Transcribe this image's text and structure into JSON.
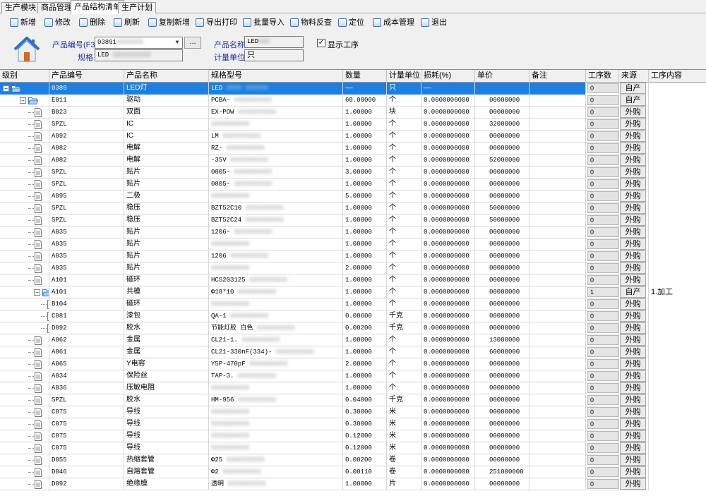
{
  "tabs": [
    {
      "label": "生产模块"
    },
    {
      "label": "商品管理"
    },
    {
      "label": "产品结构清单"
    },
    {
      "label": "生产计划"
    }
  ],
  "toolbar": [
    {
      "label": "新增"
    },
    {
      "label": "修改"
    },
    {
      "label": "删除"
    },
    {
      "label": "刷新"
    },
    {
      "label": "复制新增"
    },
    {
      "label": "导出打印"
    },
    {
      "label": "批量导入"
    },
    {
      "label": "物料反查"
    },
    {
      "label": "定位"
    },
    {
      "label": "成本管理"
    },
    {
      "label": "退出"
    }
  ],
  "form": {
    "product_code_label": "产品编号(F3)",
    "product_code_value": "03891",
    "ellipsis": "...",
    "spec_label": "规格",
    "spec_value": "LED",
    "product_name_label": "产品名称",
    "product_name_value": "LED",
    "unit_label": "计量单位",
    "unit_value": "只",
    "show_process_label": "显示工序",
    "show_process_checked": "✓"
  },
  "grid": {
    "columns": [
      "级别",
      "产品编号",
      "产品名称",
      "规格型号",
      "数量",
      "计量单位",
      "损耗(%)",
      "单价",
      "备注",
      "工序数",
      "来源",
      "工序内容"
    ],
    "rows": [
      {
        "level": 0,
        "code": "0389",
        "name": "LED灯",
        "spec": "LED",
        "qty": "——",
        "unit": "只",
        "loss": "——",
        "price": "",
        "note": "",
        "steps": "0",
        "source": "自产",
        "content": ""
      },
      {
        "level": 1,
        "code": "E011",
        "name": "驱动",
        "spec": "PCBA-",
        "qty": "60.00000",
        "unit": "个",
        "loss": "0.0000000000",
        "price": "00000000",
        "note": "",
        "steps": "0",
        "source": "自产",
        "content": ""
      },
      {
        "level": 2,
        "code": "B023",
        "name": "双面",
        "spec": "EX-POW",
        "qty": "1.00000",
        "unit": "块",
        "loss": "0.0000000000",
        "price": "00000000",
        "note": "",
        "steps": "0",
        "source": "外购",
        "content": ""
      },
      {
        "level": 2,
        "code": "SPZL",
        "name": "IC",
        "spec": "",
        "qty": "1.00000",
        "unit": "个",
        "loss": "0.0000000000",
        "price": "32000000",
        "note": "",
        "steps": "0",
        "source": "外购",
        "content": ""
      },
      {
        "level": 2,
        "code": "A092",
        "name": "IC",
        "spec": "LM",
        "qty": "1.00000",
        "unit": "个",
        "loss": "0.0000000000",
        "price": "00000000",
        "note": "",
        "steps": "0",
        "source": "外购",
        "content": ""
      },
      {
        "level": 2,
        "code": "A082",
        "name": "电解",
        "spec": "RZ-",
        "qty": "1.00000",
        "unit": "个",
        "loss": "0.0000000000",
        "price": "00000000",
        "note": "",
        "steps": "0",
        "source": "外购",
        "content": ""
      },
      {
        "level": 2,
        "code": "A082",
        "name": "电解",
        "spec": "-35V",
        "qty": "1.00000",
        "unit": "个",
        "loss": "0.0000000000",
        "price": "52000000",
        "note": "",
        "steps": "0",
        "source": "外购",
        "content": ""
      },
      {
        "level": 2,
        "code": "SPZL",
        "name": "贴片",
        "spec": "0805-",
        "qty": "3.00000",
        "unit": "个",
        "loss": "0.0000000000",
        "price": "00000000",
        "note": "",
        "steps": "0",
        "source": "外购",
        "content": ""
      },
      {
        "level": 2,
        "code": "SPZL",
        "name": "贴片",
        "spec": "0805-",
        "qty": "1.00000",
        "unit": "个",
        "loss": "0.0000000000",
        "price": "00000000",
        "note": "",
        "steps": "0",
        "source": "外购",
        "content": ""
      },
      {
        "level": 2,
        "code": "A095",
        "name": "二极",
        "spec": "",
        "qty": "5.00000",
        "unit": "个",
        "loss": "0.0000000000",
        "price": "00000000",
        "note": "",
        "steps": "0",
        "source": "外购",
        "content": ""
      },
      {
        "level": 2,
        "code": "SPZL",
        "name": "稳压",
        "spec": "BZT52C10",
        "qty": "1.00000",
        "unit": "个",
        "loss": "0.0000000000",
        "price": "50000000",
        "note": "",
        "steps": "0",
        "source": "外购",
        "content": ""
      },
      {
        "level": 2,
        "code": "SPZL",
        "name": "稳压",
        "spec": "BZT52C24",
        "qty": "1.00000",
        "unit": "个",
        "loss": "0.0000000000",
        "price": "50000000",
        "note": "",
        "steps": "0",
        "source": "外购",
        "content": ""
      },
      {
        "level": 2,
        "code": "A035",
        "name": "贴片",
        "spec": "1206-",
        "qty": "1.00000",
        "unit": "个",
        "loss": "0.0000000000",
        "price": "00000000",
        "note": "",
        "steps": "0",
        "source": "外购",
        "content": ""
      },
      {
        "level": 2,
        "code": "A035",
        "name": "贴片",
        "spec": "",
        "qty": "1.00000",
        "unit": "个",
        "loss": "0.0000000000",
        "price": "00000000",
        "note": "",
        "steps": "0",
        "source": "外购",
        "content": ""
      },
      {
        "level": 2,
        "code": "A035",
        "name": "贴片",
        "spec": "1206",
        "qty": "1.00000",
        "unit": "个",
        "loss": "0.0000000000",
        "price": "00000000",
        "note": "",
        "steps": "0",
        "source": "外购",
        "content": ""
      },
      {
        "level": 2,
        "code": "A035",
        "name": "贴片",
        "spec": "",
        "qty": "2.00000",
        "unit": "个",
        "loss": "0.0000000000",
        "price": "00000000",
        "note": "",
        "steps": "0",
        "source": "外购",
        "content": ""
      },
      {
        "level": 2,
        "code": "A101",
        "name": "磁环",
        "spec": "HCS203125",
        "qty": "1.00000",
        "unit": "个",
        "loss": "0.0000000000",
        "price": "00000000",
        "note": "",
        "steps": "0",
        "source": "外购",
        "content": ""
      },
      {
        "level": 2,
        "code": "A101",
        "name": "共模",
        "spec": "Φ18*10",
        "qty": "1.00000",
        "unit": "个",
        "loss": "0.0000000000",
        "price": "00000000",
        "note": "",
        "steps": "1",
        "source": "自产",
        "content": "1.加工",
        "folder": true
      },
      {
        "level": 3,
        "code": "B104",
        "name": "磁环",
        "spec": "",
        "qty": "1.00000",
        "unit": "个",
        "loss": "0.0000000000",
        "price": "00000000",
        "note": "",
        "steps": "0",
        "source": "外购",
        "content": ""
      },
      {
        "level": 3,
        "code": "C081",
        "name": "漆包",
        "spec": "QA-1",
        "qty": "0.00600",
        "unit": "千克",
        "loss": "0.0000000000",
        "price": "00000000",
        "note": "",
        "steps": "0",
        "source": "外购",
        "content": ""
      },
      {
        "level": 3,
        "code": "D092",
        "name": "胶水",
        "spec": "节能灯胶 白色",
        "qty": "0.00200",
        "unit": "千克",
        "loss": "0.0000000000",
        "price": "00000000",
        "note": "",
        "steps": "0",
        "source": "外购",
        "content": ""
      },
      {
        "level": 2,
        "code": "A062",
        "name": "金属",
        "spec": "CL21-1.",
        "qty": "1.00000",
        "unit": "个",
        "loss": "0.0000000000",
        "price": "13000000",
        "note": "",
        "steps": "0",
        "source": "外购",
        "content": ""
      },
      {
        "level": 2,
        "code": "A061",
        "name": "金属",
        "spec": "CL21-330nF(334)-",
        "qty": "1.00000",
        "unit": "个",
        "loss": "0.0000000000",
        "price": "60000000",
        "note": "",
        "steps": "0",
        "source": "外购",
        "content": ""
      },
      {
        "level": 2,
        "code": "A065",
        "name": "Y电容",
        "spec": "Y5P-470pF",
        "qty": "2.00000",
        "unit": "个",
        "loss": "0.0000000000",
        "price": "00000000",
        "note": "",
        "steps": "0",
        "source": "外购",
        "content": ""
      },
      {
        "level": 2,
        "code": "A034",
        "name": "保险丝",
        "spec": "TAP-3.",
        "qty": "1.00000",
        "unit": "个",
        "loss": "0.0000000000",
        "price": "00000000",
        "note": "",
        "steps": "0",
        "source": "外购",
        "content": ""
      },
      {
        "level": 2,
        "code": "A036",
        "name": "压敏电阻",
        "spec": "",
        "qty": "1.00000",
        "unit": "个",
        "loss": "0.0000000000",
        "price": "00000000",
        "note": "",
        "steps": "0",
        "source": "外购",
        "content": ""
      },
      {
        "level": 2,
        "code": "SPZL",
        "name": "胶水",
        "spec": "HM-956",
        "qty": "0.04000",
        "unit": "千克",
        "loss": "0.0000000000",
        "price": "00000000",
        "note": "",
        "steps": "0",
        "source": "外购",
        "content": ""
      },
      {
        "level": 2,
        "code": "C075",
        "name": "导线",
        "spec": "",
        "qty": "0.30000",
        "unit": "米",
        "loss": "0.0000000000",
        "price": "00000000",
        "note": "",
        "steps": "0",
        "source": "外购",
        "content": ""
      },
      {
        "level": 2,
        "code": "C075",
        "name": "导线",
        "spec": "",
        "qty": "0.30000",
        "unit": "米",
        "loss": "0.0000000000",
        "price": "00000000",
        "note": "",
        "steps": "0",
        "source": "外购",
        "content": ""
      },
      {
        "level": 2,
        "code": "C075",
        "name": "导线",
        "spec": "",
        "qty": "0.12000",
        "unit": "米",
        "loss": "0.0000000000",
        "price": "00000000",
        "note": "",
        "steps": "0",
        "source": "外购",
        "content": ""
      },
      {
        "level": 2,
        "code": "C075",
        "name": "导线",
        "spec": "",
        "qty": "0.12000",
        "unit": "米",
        "loss": "0.0000000000",
        "price": "00000000",
        "note": "",
        "steps": "0",
        "source": "外购",
        "content": ""
      },
      {
        "level": 2,
        "code": "D055",
        "name": "热缩套管",
        "spec": "Φ25",
        "qty": "0.00200",
        "unit": "卷",
        "loss": "0.0000000000",
        "price": "00000000",
        "note": "",
        "steps": "0",
        "source": "外购",
        "content": ""
      },
      {
        "level": 2,
        "code": "D046",
        "name": "自熔套管",
        "spec": "Φ2",
        "qty": "0.00110",
        "unit": "卷",
        "loss": "0.0000000000",
        "price": "251000000",
        "note": "",
        "steps": "0",
        "source": "外购",
        "content": ""
      },
      {
        "level": 2,
        "code": "D092",
        "name": "绝缘膜",
        "spec": "透明",
        "qty": "1.00000",
        "unit": "片",
        "loss": "0.0000000000",
        "price": "00000000",
        "note": "",
        "steps": "0",
        "source": "外购",
        "content": ""
      }
    ]
  },
  "colors": {
    "selection": "#1d7fe0",
    "label_blue": "#1d2fa0"
  }
}
